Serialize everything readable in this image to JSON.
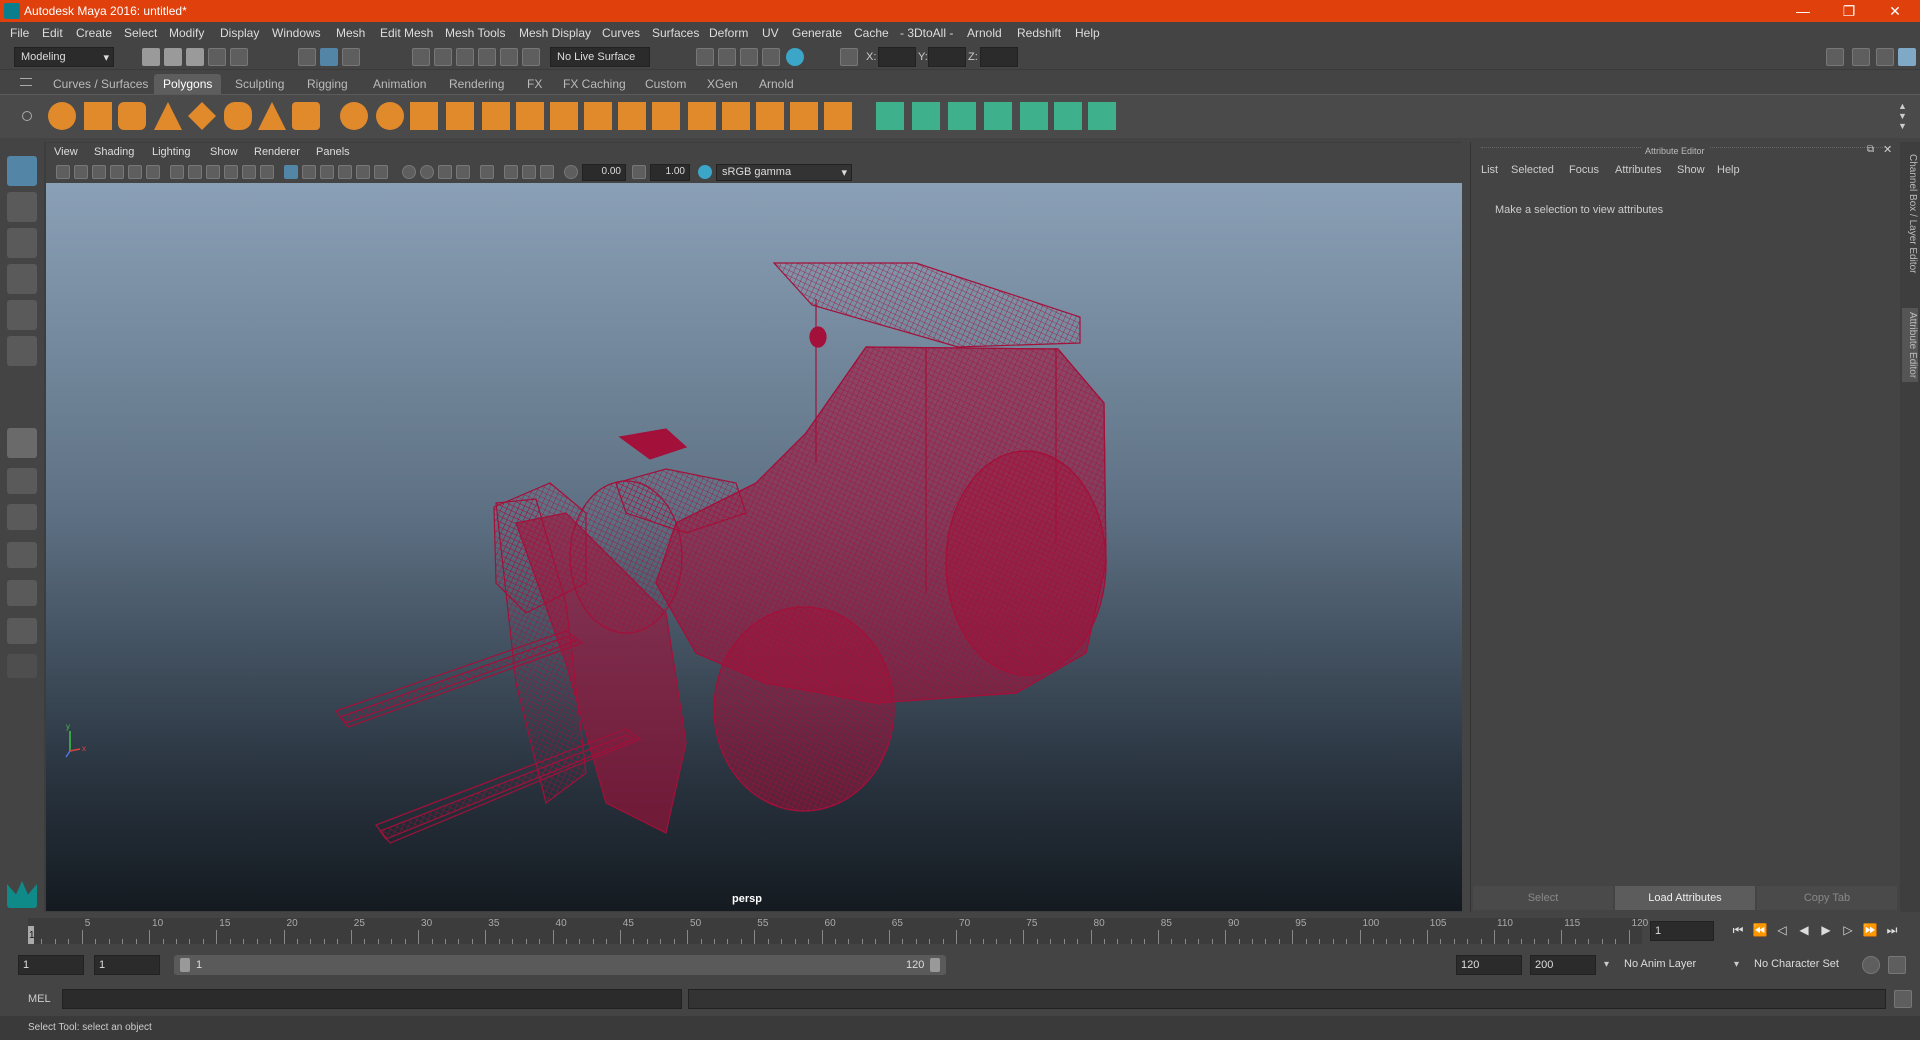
{
  "window": {
    "title": "Autodesk Maya 2016: untitled*",
    "minimize": "—",
    "restore": "❐",
    "close": "✕"
  },
  "menubar": [
    "File",
    "Edit",
    "Create",
    "Select",
    "Modify",
    "Display",
    "Windows",
    "Mesh",
    "Edit Mesh",
    "Mesh Tools",
    "Mesh Display",
    "Curves",
    "Surfaces",
    "Deform",
    "UV",
    "Generate",
    "Cache",
    "- 3DtoAll -",
    "Arnold",
    "Redshift",
    "Help"
  ],
  "statusline": {
    "mode": "Modeling",
    "live_surface": "No Live Surface",
    "x_label": "X:",
    "y_label": "Y:",
    "z_label": "Z:"
  },
  "shelf_tabs": [
    "Curves / Surfaces",
    "Polygons",
    "Sculpting",
    "Rigging",
    "Animation",
    "Rendering",
    "FX",
    "FX Caching",
    "Custom",
    "XGen",
    "Arnold"
  ],
  "shelf_active_tab": "Polygons",
  "panel_menu": [
    "View",
    "Shading",
    "Lighting",
    "Show",
    "Renderer",
    "Panels"
  ],
  "panel_tools": {
    "exposure": "0.00",
    "gamma": "1.00",
    "colorspace": "sRGB gamma"
  },
  "viewport": {
    "camera_label": "persp",
    "axis_y": "y",
    "axis_x": "x"
  },
  "attribute_editor": {
    "title": "Attribute Editor",
    "menu": [
      "List",
      "Selected",
      "Focus",
      "Attributes",
      "Show",
      "Help"
    ],
    "message": "Make a selection to view attributes",
    "buttons": {
      "select": "Select",
      "load": "Load Attributes",
      "copy": "Copy Tab"
    }
  },
  "side_tabs": {
    "channel_box": "Channel Box / Layer Editor",
    "attribute_editor": "Attribute Editor"
  },
  "timeline": {
    "ticks": [
      "5",
      "10",
      "15",
      "20",
      "25",
      "30",
      "35",
      "40",
      "45",
      "50",
      "55",
      "60",
      "65",
      "70",
      "75",
      "80",
      "85",
      "90",
      "95",
      "100",
      "105",
      "110",
      "115",
      "120"
    ],
    "start_marker": "1",
    "current_frame": "1"
  },
  "range": {
    "start": "1",
    "playback_start": "1",
    "slider_start": "1",
    "slider_end": "120",
    "playback_end": "120",
    "end": "200",
    "anim_layer": "No Anim Layer",
    "char_set": "No Character Set"
  },
  "cmdline": {
    "lang": "MEL"
  },
  "helpline": {
    "text": "Select Tool: select an object"
  },
  "colors": {
    "titlebar": "#e0400c",
    "wireframe": "#a3103a",
    "shelf_icon": "#e08a2c",
    "shelf_icon_green": "#3fb08c"
  }
}
